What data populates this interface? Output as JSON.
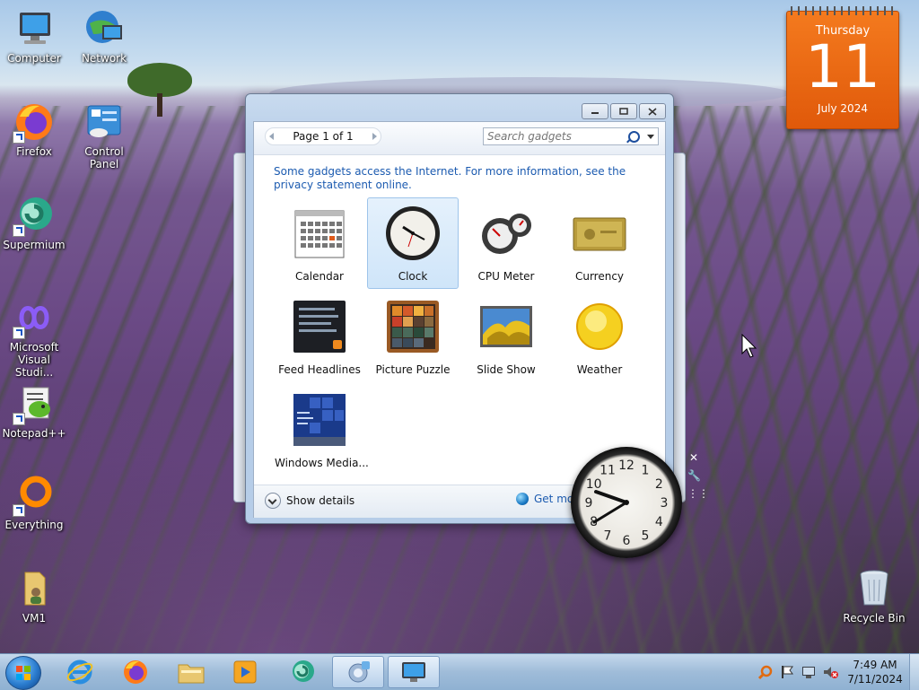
{
  "desktop": {
    "icons": [
      {
        "label": "Computer"
      },
      {
        "label": "Network"
      },
      {
        "label": "Firefox"
      },
      {
        "label": "Control Panel"
      },
      {
        "label": "Supermium"
      },
      {
        "label": "Microsoft Visual Studi..."
      },
      {
        "label": "Notepad++"
      },
      {
        "label": "Everything"
      },
      {
        "label": "VM1"
      },
      {
        "label": "Recycle Bin"
      }
    ]
  },
  "calendar_gadget": {
    "weekday": "Thursday",
    "day": "11",
    "month_year": "July 2024"
  },
  "gadget_window": {
    "window_buttons": [
      "minimize",
      "restore",
      "close"
    ],
    "page_label": "Page 1 of 1",
    "search": {
      "placeholder": "Search gadgets",
      "value": ""
    },
    "notice": "Some gadgets access the Internet.  For more information, see the privacy statement online.",
    "gadgets": [
      {
        "label": "Calendar",
        "selected": false
      },
      {
        "label": "Clock",
        "selected": true
      },
      {
        "label": "CPU Meter",
        "selected": false
      },
      {
        "label": "Currency",
        "selected": false
      },
      {
        "label": "Feed Headlines",
        "selected": false
      },
      {
        "label": "Picture Puzzle",
        "selected": false
      },
      {
        "label": "Slide Show",
        "selected": false
      },
      {
        "label": "Weather",
        "selected": false
      },
      {
        "label": "Windows Media...",
        "selected": false
      }
    ],
    "show_details": "Show details",
    "get_more": "Get more"
  },
  "clock_gadget": {
    "numbers": [
      "12",
      "1",
      "2",
      "3",
      "4",
      "5",
      "6",
      "7",
      "8",
      "9",
      "10",
      "11"
    ],
    "time": "7:49"
  },
  "taskbar": {
    "apps": [
      "Internet Explorer",
      "Firefox",
      "Windows Explorer",
      "Windows Media Player",
      "Supermium",
      "Gadgets",
      "Remote Desktop"
    ],
    "clock_time": "7:49 AM",
    "clock_date": "7/11/2024"
  },
  "colors": {
    "accent": "#1c5bb0",
    "calendar": "#ee6a14",
    "taskbar": "#a7c2dd"
  }
}
